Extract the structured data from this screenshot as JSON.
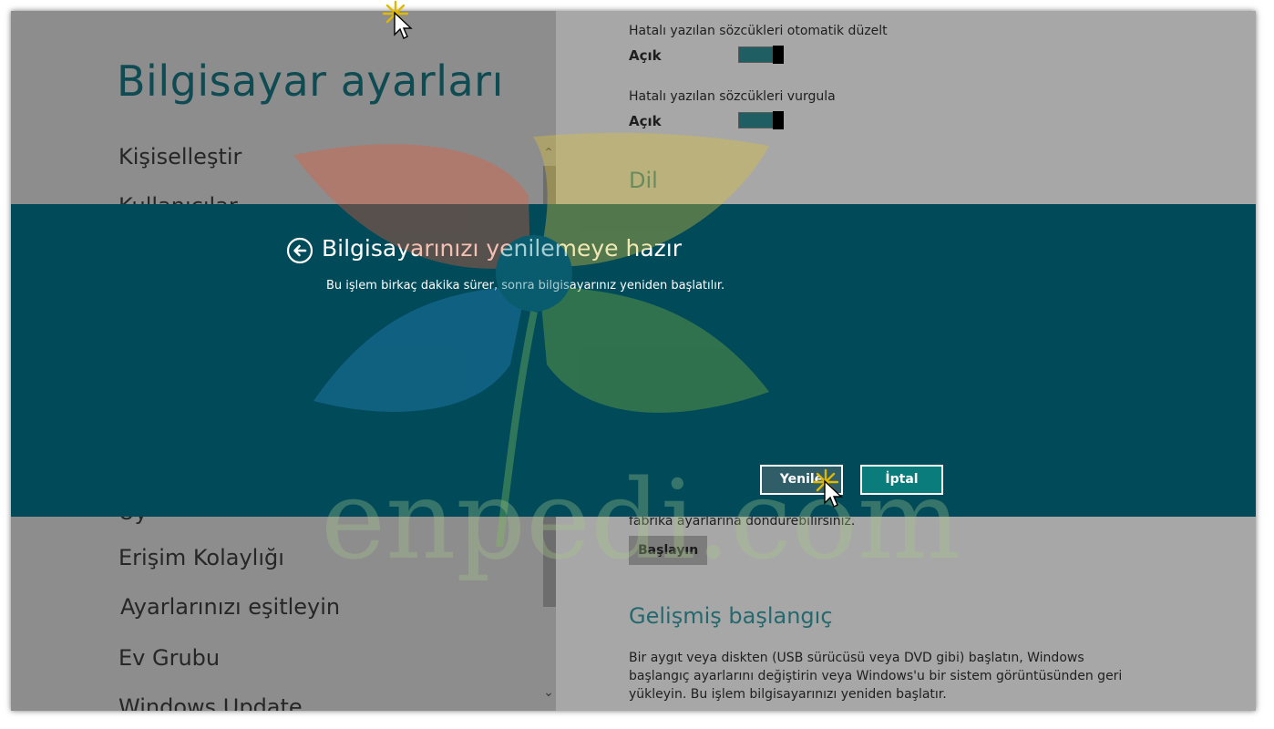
{
  "left_pane": {
    "title": "Bilgisayar ayarları",
    "items": [
      {
        "label": "Kişiselleştir"
      },
      {
        "label": "Kullanıcılar"
      },
      {
        "label": "Uy"
      },
      {
        "label": "Erişim Kolaylığı"
      },
      {
        "label": "Ayarlarınızı eşitleyin"
      },
      {
        "label": "Ev Grubu"
      },
      {
        "label": "Windows Update"
      }
    ]
  },
  "right_pane": {
    "autocorrect_label": "Hatalı yazılan sözcükleri otomatik düzelt",
    "autocorrect_state": "Açık",
    "highlight_label": "Hatalı yazılan sözcükleri vurgula",
    "highlight_state": "Açık",
    "language_heading": "Dil",
    "reset_text_tail": "fabrika ayarlarına döndürebilirsiniz.",
    "reset_button": "Başlayın",
    "advanced_heading": "Gelişmiş başlangıç",
    "advanced_text": "Bir aygıt veya diskten (USB sürücüsü veya DVD gibi) başlatın, Windows başlangıç ayarlarını değiştirin veya Windows'u bir sistem görüntüsünden geri yükleyin. Bu işlem bilgisayarınızı yeniden başlatır."
  },
  "dialog": {
    "title": "Bilgisayarınızı yenilemeye hazır",
    "message": "Bu işlem birkaç dakika sürer, sonra bilgisayarınız yeniden başlatılır.",
    "refresh_button": "Yenile",
    "cancel_button": "İptal"
  },
  "watermark": {
    "text": "enpedi.com"
  },
  "colors": {
    "dialog_bg": "#004a5a",
    "accent_teal": "#0a7c7c",
    "title_teal": "#0f4b52"
  }
}
